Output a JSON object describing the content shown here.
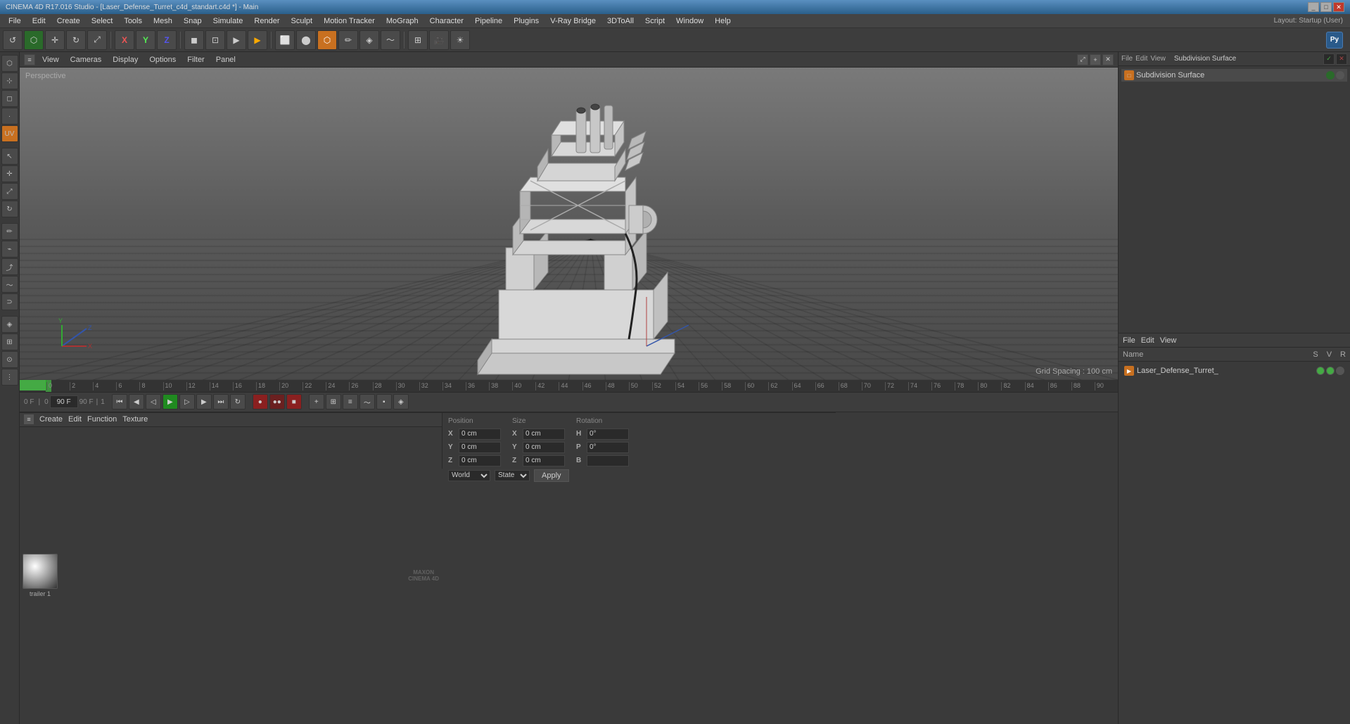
{
  "title_bar": {
    "title": "CINEMA 4D R17.016 Studio - [Laser_Defense_Turret_c4d_standart.c4d *] - Main",
    "min_label": "_",
    "max_label": "□",
    "close_label": "✕"
  },
  "menu_bar": {
    "items": [
      "File",
      "Edit",
      "Create",
      "Select",
      "Tools",
      "Mesh",
      "Snap",
      "Simulate",
      "Render",
      "Sculpt",
      "Motion Tracker",
      "MoGraph",
      "Character",
      "Pipeline",
      "Plugins",
      "V-Ray Bridge",
      "3DToAll",
      "Script",
      "Window",
      "Help"
    ]
  },
  "layout": {
    "label": "Layout:",
    "value": "Startup (User)"
  },
  "viewport": {
    "label": "Perspective",
    "grid_spacing": "Grid Spacing : 100 cm",
    "menus": [
      "View",
      "Cameras",
      "Display",
      "Options",
      "Filter",
      "Panel"
    ]
  },
  "object_manager": {
    "menus": [
      "File",
      "Edit",
      "View"
    ],
    "columns": {
      "name": "Name",
      "s": "S",
      "v": "V",
      "r": "R"
    },
    "items": [
      {
        "name": "Laser_Defense_Turret_",
        "icon": "folder",
        "color": "orange"
      }
    ]
  },
  "timeline": {
    "current_frame": "0 F",
    "start_frame": "0",
    "end_frame": "90 F",
    "fps": "90 F",
    "playback": "1",
    "ticks": [
      "0",
      "2",
      "4",
      "6",
      "8",
      "10",
      "12",
      "14",
      "16",
      "18",
      "20",
      "22",
      "24",
      "26",
      "28",
      "30",
      "32",
      "34",
      "36",
      "38",
      "40",
      "42",
      "44",
      "46",
      "48",
      "50",
      "52",
      "54",
      "56",
      "58",
      "60",
      "62",
      "64",
      "66",
      "68",
      "70",
      "72",
      "74",
      "76",
      "78",
      "80",
      "82",
      "84",
      "86",
      "88",
      "90"
    ]
  },
  "coordinates": {
    "x_pos": "0 cm",
    "y_pos": "0 cm",
    "z_pos": "0 cm",
    "x_size": "0 cm",
    "y_size": "0 cm",
    "z_size": "0 cm",
    "h_rot": "0°",
    "p_rot": "0°",
    "b_rot": "",
    "coord_sys": "World",
    "state_label": "State",
    "apply_label": "Apply"
  },
  "material": {
    "label": "trailer 1",
    "menus": [
      "Create",
      "Edit",
      "Function",
      "Texture"
    ]
  },
  "attribute_panel": {
    "title": "Subdivision Surface"
  },
  "icons": {
    "undo": "↺",
    "mode_model": "⬡",
    "axis_x": "X",
    "axis_y": "Y",
    "axis_z": "Z",
    "render": "▶",
    "camera": "📷",
    "play": "▶",
    "stop": "■",
    "prev": "◀",
    "next": "▶",
    "first": "⏮",
    "last": "⏭",
    "record": "●",
    "key": "◆"
  }
}
